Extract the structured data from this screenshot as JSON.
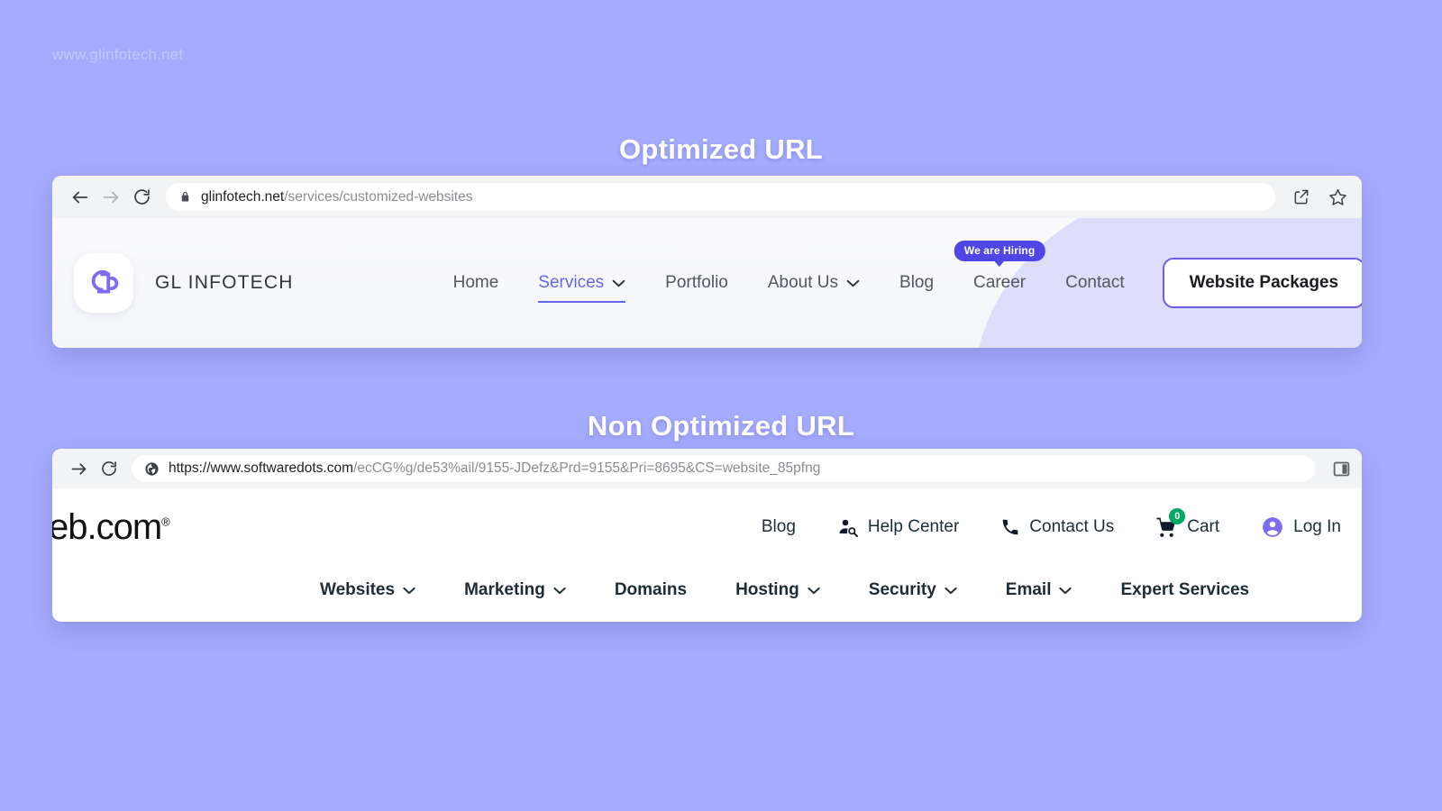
{
  "watermark": "www.glinfotech.net",
  "colors": {
    "page_background": "#a5abfd",
    "accent_purple": "#6366f1",
    "badge_purple": "#4f46e5",
    "cart_badge_green": "#00a862",
    "deco_circle": "#dcdefb"
  },
  "sections": {
    "optimized": {
      "title": "Optimized URL",
      "browser": {
        "back_icon": "back-arrow-icon",
        "forward_icon": "forward-arrow-icon",
        "reload_icon": "reload-icon",
        "security_icon": "lock-icon",
        "url_domain": "glinfotech.net",
        "url_path": "/services/customized-websites",
        "share_icon": "share-icon",
        "bookmark_icon": "star-icon"
      },
      "site": {
        "logo_icon": "gl-monogram-logo",
        "brand": "GL INFOTECH",
        "nav": [
          {
            "label": "Home",
            "caret": false,
            "active": false
          },
          {
            "label": "Services",
            "caret": true,
            "active": true
          },
          {
            "label": "Portfolio",
            "caret": false,
            "active": false
          },
          {
            "label": "About Us",
            "caret": true,
            "active": false
          },
          {
            "label": "Blog",
            "caret": false,
            "active": false
          },
          {
            "label": "Career",
            "caret": false,
            "active": false,
            "badge": "We are Hiring"
          },
          {
            "label": "Contact",
            "caret": false,
            "active": false
          }
        ],
        "cta": "Website Packages"
      }
    },
    "non_optimized": {
      "title": "Non Optimized URL",
      "browser": {
        "forward_icon": "forward-arrow-icon",
        "reload_icon": "reload-icon",
        "security_icon": "globe-icon",
        "url_domain": "https://www.softwaredots.com",
        "url_path": "/ecCG%g/de53%ail/9155-JDefz&Prd=9155&Pri=8695&CS=website_85pfng",
        "panel_icon": "side-panel-icon"
      },
      "site": {
        "logo_text": "eb.com",
        "logo_mark": "®",
        "util_nav": [
          {
            "label": "Blog",
            "icon": null
          },
          {
            "label": "Help Center",
            "icon": "person-search-icon"
          },
          {
            "label": "Contact Us",
            "icon": "phone-icon"
          },
          {
            "label": "Cart",
            "icon": "cart-icon",
            "badge": "0"
          },
          {
            "label": "Log In",
            "icon": "account-circle-icon"
          }
        ],
        "main_nav": [
          {
            "label": "Websites",
            "caret": true
          },
          {
            "label": "Marketing",
            "caret": true
          },
          {
            "label": "Domains",
            "caret": false
          },
          {
            "label": "Hosting",
            "caret": true
          },
          {
            "label": "Security",
            "caret": true
          },
          {
            "label": "Email",
            "caret": true
          },
          {
            "label": "Expert Services",
            "caret": false
          }
        ]
      }
    }
  }
}
